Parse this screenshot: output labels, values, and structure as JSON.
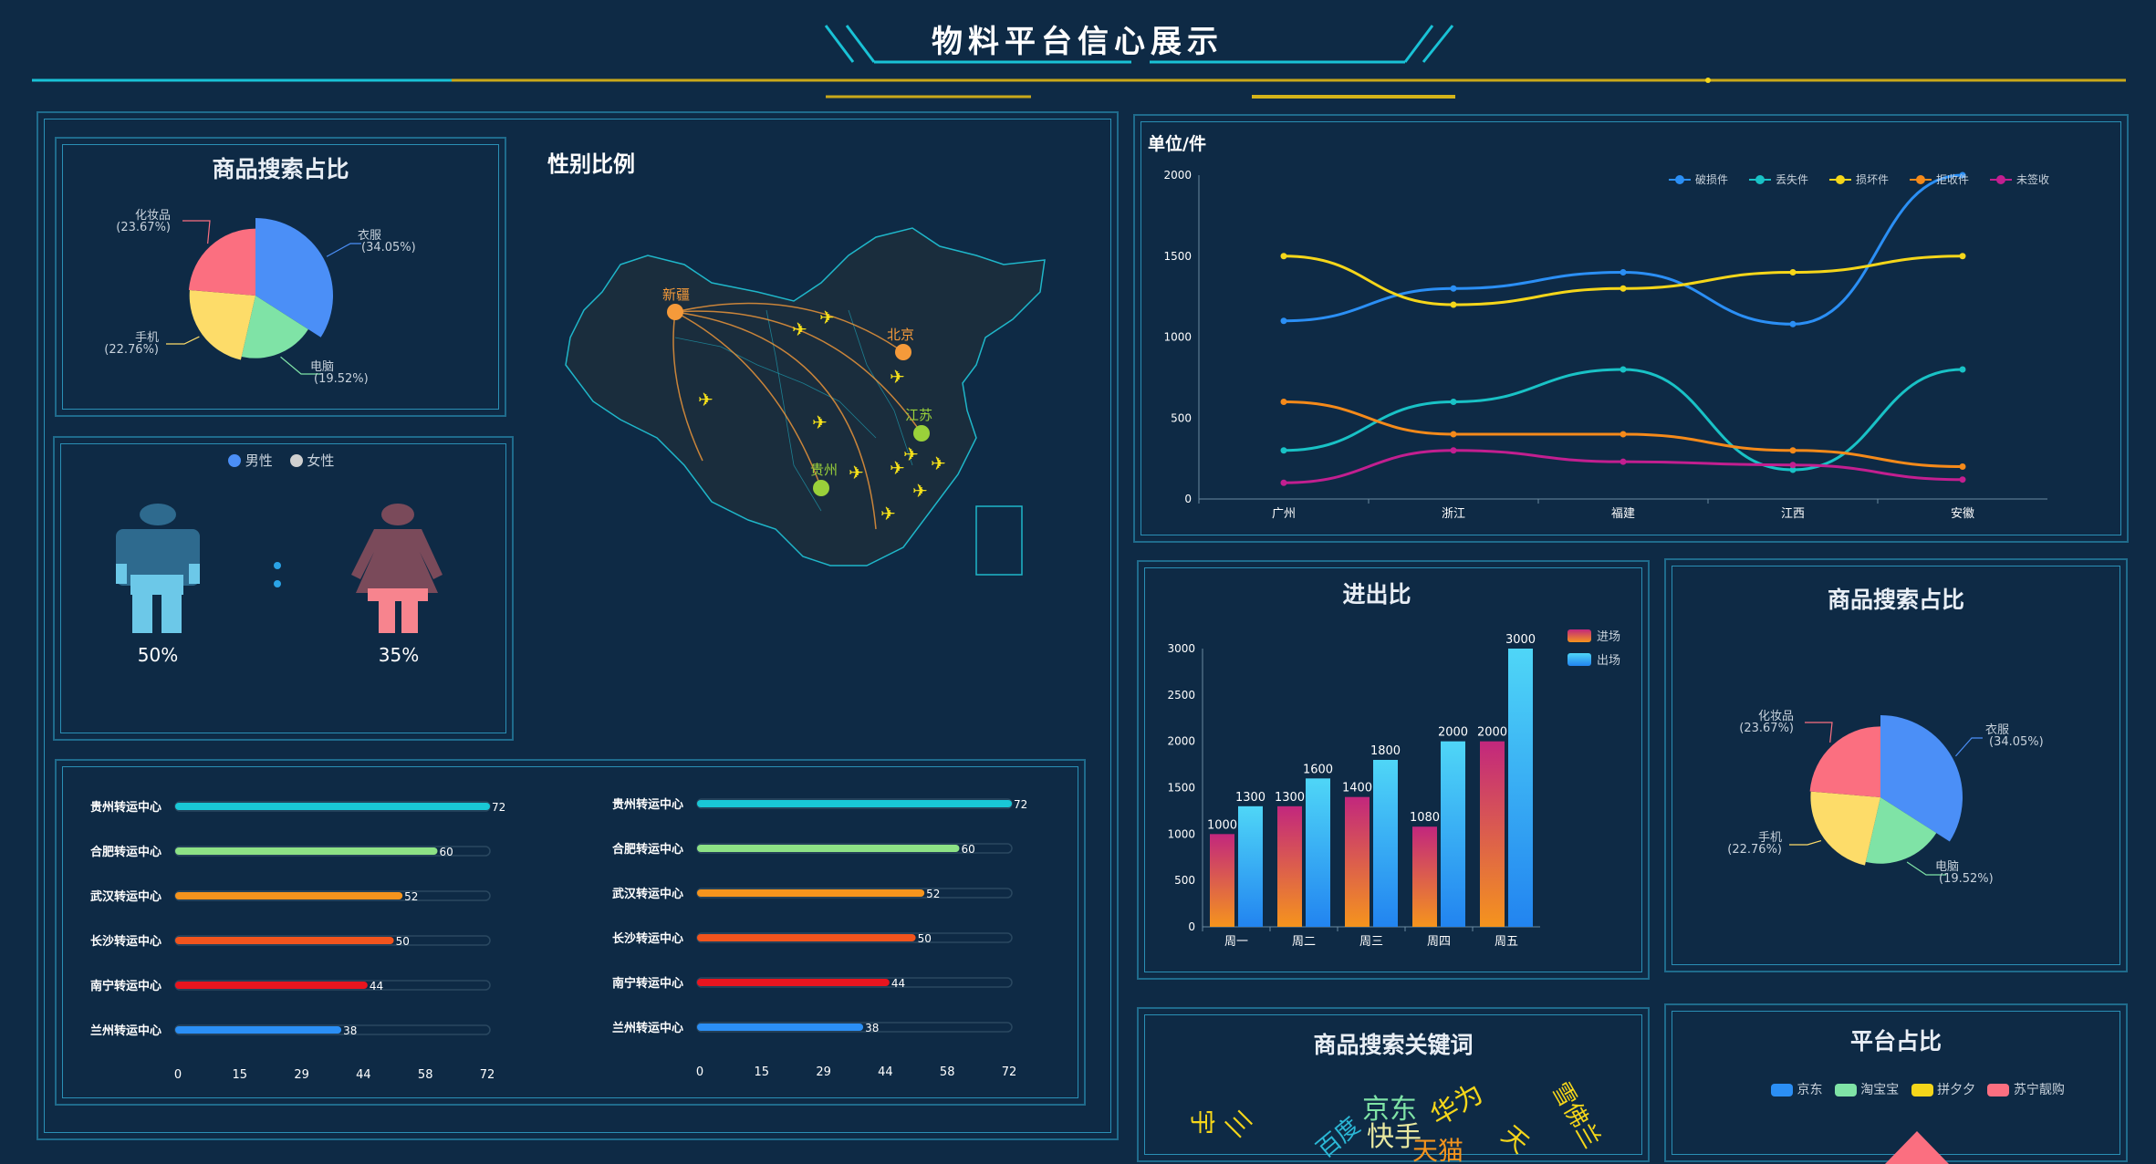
{
  "header": {
    "title": "物料平台信心展示",
    "accent_color": "#19c2d6",
    "line_color": "#d4b41a"
  },
  "pie_left": {
    "title": "商品搜索占比",
    "slices": [
      {
        "name": "衣服",
        "pct": "(34.05%)",
        "value": 34.05,
        "color": "#4b8ff7"
      },
      {
        "name": "电脑",
        "pct": "(19.52%)",
        "value": 19.52,
        "color": "#7fe3a6"
      },
      {
        "name": "手机",
        "pct": "(22.76%)",
        "value": 22.76,
        "color": "#fddc69"
      },
      {
        "name": "化妆品",
        "pct": "(23.67%)",
        "value": 23.67,
        "color": "#fb6f80"
      }
    ]
  },
  "gender": {
    "title": "性别比例",
    "legend_male": "男性",
    "legend_female": "女性",
    "male_pct": "50%",
    "female_pct": "35%",
    "male_value": 50,
    "female_value": 35
  },
  "map": {
    "cities": [
      "新疆",
      "北京",
      "江苏",
      "贵州"
    ]
  },
  "bars_left": {
    "rows": [
      {
        "name": "贵州转运中心",
        "value": 72,
        "color": "#19c7d6"
      },
      {
        "name": "合肥转运中心",
        "value": 60,
        "color": "#8de285"
      },
      {
        "name": "武汉转运中心",
        "value": 52,
        "color": "#f5941d"
      },
      {
        "name": "长沙转运中心",
        "value": 50,
        "color": "#f2541d"
      },
      {
        "name": "南宁转运中心",
        "value": 44,
        "color": "#e8151f"
      },
      {
        "name": "兰州转运中心",
        "value": 38,
        "color": "#2b8ff5"
      }
    ],
    "ticks": [
      "0",
      "15",
      "29",
      "44",
      "58",
      "72"
    ]
  },
  "line_chart": {
    "unit_label": "单位/件",
    "categories": [
      "广州",
      "浙江",
      "福建",
      "江西",
      "安徽"
    ],
    "y_ticks": [
      "2000",
      "1500",
      "1000",
      "500",
      "0"
    ],
    "series": [
      {
        "name": "破损件",
        "color": "#2b8ff5",
        "values": [
          1100,
          1300,
          1400,
          1080,
          2000
        ]
      },
      {
        "name": "丢失件",
        "color": "#19c2c6",
        "values": [
          300,
          600,
          800,
          180,
          800
        ]
      },
      {
        "name": "损坏件",
        "color": "#f5d61a",
        "values": [
          1500,
          1200,
          1300,
          1400,
          1500
        ]
      },
      {
        "name": "拒收件",
        "color": "#f58a1a",
        "values": [
          600,
          400,
          400,
          300,
          200
        ]
      },
      {
        "name": "未签收",
        "color": "#c21f90",
        "values": [
          100,
          300,
          230,
          210,
          120
        ]
      }
    ]
  },
  "in_out": {
    "title": "进出比",
    "legend_in": "进场",
    "legend_out": "出场",
    "categories": [
      "周一",
      "周二",
      "周三",
      "周四",
      "周五"
    ],
    "in_values": [
      1000,
      1300,
      1400,
      1080,
      2000
    ],
    "out_values": [
      1300,
      1600,
      1800,
      2000,
      3000
    ],
    "in_labels": [
      "1000",
      "1300",
      "1400",
      "1080",
      "2000"
    ],
    "out_labels": [
      "1300",
      "1600",
      "1800",
      "2000",
      "3000"
    ],
    "y_ticks": [
      "3000",
      "2500",
      "2000",
      "1500",
      "1000",
      "500",
      "0"
    ]
  },
  "pie_right": {
    "title": "商品搜索占比"
  },
  "keywords": {
    "title": "商品搜索关键词",
    "words": [
      "京东",
      "华为",
      "快手",
      "百度",
      "宇",
      "三",
      "天猫",
      "雪佛兰",
      "天"
    ]
  },
  "platform": {
    "title": "平台占比",
    "legend": [
      {
        "name": "京东",
        "color": "#2b8ff5"
      },
      {
        "name": "淘宝宝",
        "color": "#7fe3a6"
      },
      {
        "name": "拼夕夕",
        "color": "#f5d61a"
      },
      {
        "name": "苏宁靓购",
        "color": "#fb6f80"
      }
    ]
  },
  "chart_data": [
    {
      "type": "pie",
      "title": "商品搜索占比",
      "categories": [
        "衣服",
        "电脑",
        "手机",
        "化妆品"
      ],
      "values": [
        34.05,
        19.52,
        22.76,
        23.67
      ]
    },
    {
      "type": "line",
      "ylabel": "单位/件",
      "categories": [
        "广州",
        "浙江",
        "福建",
        "江西",
        "安徽"
      ],
      "ylim": [
        0,
        2000
      ],
      "series": [
        {
          "name": "破损件",
          "values": [
            1100,
            1300,
            1400,
            1080,
            2000
          ]
        },
        {
          "name": "丢失件",
          "values": [
            300,
            600,
            800,
            180,
            800
          ]
        },
        {
          "name": "损坏件",
          "values": [
            1500,
            1200,
            1300,
            1400,
            1500
          ]
        },
        {
          "name": "拒收件",
          "values": [
            600,
            400,
            400,
            300,
            200
          ]
        },
        {
          "name": "未签收",
          "values": [
            100,
            300,
            230,
            210,
            120
          ]
        }
      ],
      "legend": "top-right"
    },
    {
      "type": "bar",
      "title": "进出比",
      "categories": [
        "周一",
        "周二",
        "周三",
        "周四",
        "周五"
      ],
      "ylim": [
        0,
        3000
      ],
      "series": [
        {
          "name": "进场",
          "values": [
            1000,
            1300,
            1400,
            1080,
            2000
          ]
        },
        {
          "name": "出场",
          "values": [
            1300,
            1600,
            1800,
            2000,
            3000
          ]
        }
      ]
    },
    {
      "type": "bar",
      "categories": [
        "贵州转运中心",
        "合肥转运中心",
        "武汉转运中心",
        "长沙转运中心",
        "南宁转运中心",
        "兰州转运中心"
      ],
      "values": [
        72,
        60,
        52,
        50,
        44,
        38
      ],
      "xlim": [
        0,
        72
      ]
    }
  ]
}
